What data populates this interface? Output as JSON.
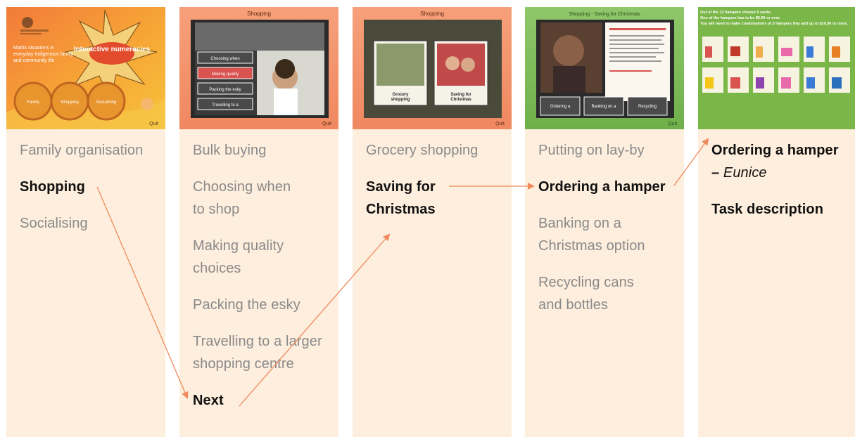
{
  "columns": [
    {
      "screen": {
        "title": "Interactive numeracies",
        "tagline": "Maths situations in everyday Indigenous family and community life",
        "circles": [
          "Family organisation",
          "Shopping",
          "Socialising"
        ],
        "footer_quit": "Quit"
      },
      "items": [
        {
          "text": "Family organisation",
          "active": false
        },
        {
          "text": "Shopping",
          "active": true
        },
        {
          "text": "Socialising",
          "active": false
        }
      ]
    },
    {
      "screen": {
        "title": "Shopping",
        "menu": [
          "Choosing when to shop",
          "Making quality choices",
          "Packing the esky",
          "Travelling to a larger shopping centre"
        ],
        "footer_quit": "Quit"
      },
      "items": [
        {
          "text": "Bulk buying",
          "active": false
        },
        {
          "text": "Choosing when",
          "active": false,
          "gap": 0
        },
        {
          "text": "to shop",
          "active": false,
          "cont": true
        },
        {
          "text": "Making quality",
          "active": false
        },
        {
          "text": "choices",
          "active": false,
          "cont": true
        },
        {
          "text": "Packing the esky",
          "active": false
        },
        {
          "text": "Travelling to a larger",
          "active": false
        },
        {
          "text": "shopping centre",
          "active": false,
          "cont": true
        },
        {
          "text": "Next",
          "active": true
        }
      ]
    },
    {
      "screen": {
        "title": "Shopping",
        "cards": [
          "Grocery shopping",
          "Saving for Christmas"
        ],
        "footer_quit": "Quit"
      },
      "items": [
        {
          "text": "Grocery shopping",
          "active": false
        },
        {
          "text": "Saving for",
          "active": true
        },
        {
          "text": "Christmas",
          "active": true,
          "cont": true
        }
      ]
    },
    {
      "screen": {
        "title": "Shopping - Saving for Christmas",
        "options": [
          "Ordering a hamper",
          "Banking on a Christmas option",
          "Recycling"
        ],
        "footer_quit": "Quit"
      },
      "items": [
        {
          "text": "Putting on lay-by",
          "active": false
        },
        {
          "text": "Ordering a hamper",
          "active": true
        },
        {
          "text": "Banking on a",
          "active": false
        },
        {
          "text": "Christmas option",
          "active": false,
          "cont": true
        },
        {
          "text": "Recycling cans",
          "active": false
        },
        {
          "text": "and bottles",
          "active": false,
          "cont": true
        }
      ]
    },
    {
      "screen": {
        "instructions": [
          "Out of the 12 hampers choose 5 cards.",
          "One of the hampers has to be $5.00 or over.",
          "You will need to make combinations of 3 hampers that add up to $10.00 or more."
        ]
      },
      "items": [
        {
          "text": "Ordering a hamper",
          "active": true
        },
        {
          "text": "– ",
          "active": true,
          "cont": true,
          "italic_suffix": "Eunice"
        },
        {
          "text": "Task description",
          "active": true
        }
      ]
    }
  ],
  "colors": {
    "panel_bg": "#fdeedd",
    "inactive_text": "#8a8a8a",
    "active_text": "#111111",
    "arrow": "#f08a5d"
  }
}
